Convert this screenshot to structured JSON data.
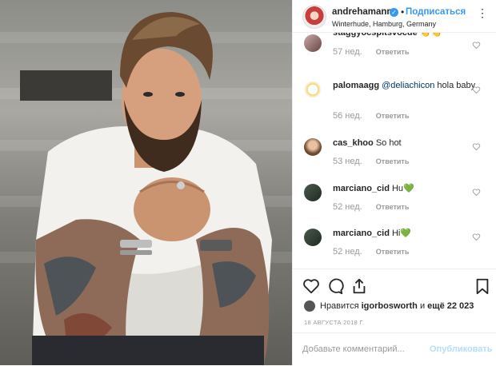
{
  "header": {
    "username": "andrehamann",
    "follow_label": "Подписаться",
    "separator": "•",
    "location": "Winterhude, Hamburg, Germany",
    "verified_icon": "✓",
    "more_icon": "⋮"
  },
  "comments": [
    {
      "user": "staggyocspitsvocue",
      "text": "👏👏",
      "time": "57 нед.",
      "reply": "Ответить",
      "partial": true
    },
    {
      "user": "palomaagg",
      "mention": "@deliachicon",
      "text": "hola baby",
      "time": "56 нед.",
      "reply": "Ответить"
    },
    {
      "user": "cas_khoo",
      "text": "So hot",
      "time": "53 нед.",
      "reply": "Ответить"
    },
    {
      "user": "marciano_cid",
      "text": "Hu💚",
      "time": "52 нед.",
      "reply": "Ответить"
    },
    {
      "user": "marciano_cid",
      "text": "Hi💚",
      "time": "52 нед.",
      "reply": "Ответить"
    }
  ],
  "actions": {
    "likes_prefix": "Нравится",
    "likes_user": "igorbosworth",
    "likes_conj": "и",
    "likes_rest": "ещё 22 023",
    "date": "18 АВГУСТА 2018 Г."
  },
  "comment_box": {
    "placeholder": "Добавьте комментарий...",
    "publish_label": "Опубликовать"
  },
  "colors": {
    "accent": "#3897f0",
    "muted": "#999999",
    "border": "#efefef"
  }
}
